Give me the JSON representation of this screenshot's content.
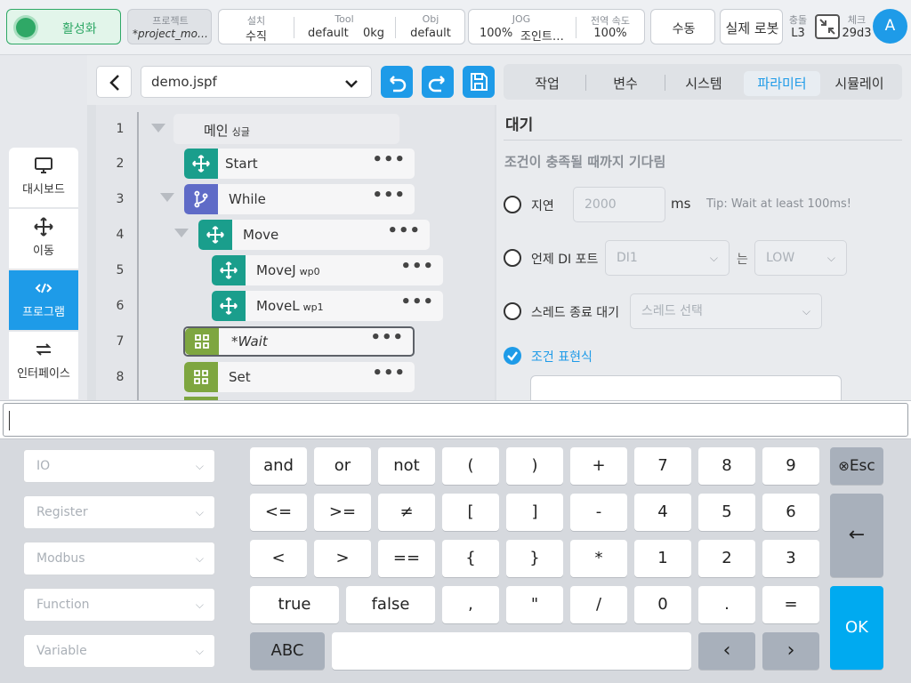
{
  "topbar": {
    "activate_label": "활성화",
    "project": {
      "label": "프로젝트",
      "value": "*project_mo…"
    },
    "install": {
      "label": "설치",
      "value": "수직"
    },
    "tool": {
      "label": "Tool",
      "value_name": "default",
      "value_weight": "0kg"
    },
    "obj": {
      "label": "Obj",
      "value": "default"
    },
    "jog": {
      "label": "JOG",
      "value_percent": "100%",
      "value_mode": "조인트…"
    },
    "global_speed": {
      "label": "전역 속도",
      "value": "100%"
    },
    "manual_label": "수동",
    "real_robot_label": "실제 로봇",
    "collision": {
      "label": "충돌",
      "value": "L3"
    },
    "check": {
      "label": "체크",
      "value": "29d3"
    },
    "avatar_letter": "A"
  },
  "nav": {
    "items": [
      {
        "label": "대시보드",
        "icon": "monitor-icon"
      },
      {
        "label": "이동",
        "icon": "move-arrows-icon"
      },
      {
        "label": "프로그램",
        "icon": "code-icon"
      },
      {
        "label": "인터페이스",
        "icon": "swap-arrows-icon"
      }
    ],
    "active_index": 2
  },
  "program": {
    "file_name": "demo.jspf",
    "lines": [
      {
        "no": "1",
        "label": "메인",
        "sub": "싱글"
      },
      {
        "no": "2",
        "label": "Start",
        "sub": ""
      },
      {
        "no": "3",
        "label": "While",
        "sub": ""
      },
      {
        "no": "4",
        "label": "Move",
        "sub": ""
      },
      {
        "no": "5",
        "label": "MoveJ",
        "sub": "wp0"
      },
      {
        "no": "6",
        "label": "MoveL",
        "sub": "wp1"
      },
      {
        "no": "7",
        "label": "*Wait",
        "sub": ""
      },
      {
        "no": "8",
        "label": "Set",
        "sub": ""
      }
    ],
    "selected_line": "7"
  },
  "tabs": [
    "작업",
    "변수",
    "시스템",
    "파라미터",
    "시뮬레이"
  ],
  "active_tab": "파라미터",
  "wait_panel": {
    "title": "대기",
    "subtitle": "조건이 충족될 때까지 기다림",
    "delay": {
      "label": "지연",
      "value": "2000",
      "unit": "ms",
      "tip": "Tip: Wait at least 100ms!"
    },
    "di_port": {
      "label": "언제 DI 포트",
      "port": "DI1",
      "is_label": "는",
      "level": "LOW"
    },
    "thread": {
      "label": "스레드 종료 대기",
      "placeholder": "스레드 선택"
    },
    "condition": {
      "label": "조건 표현식",
      "checked": true
    }
  },
  "expression": {
    "value": ""
  },
  "keyboard": {
    "selects": [
      "IO",
      "Register",
      "Modbus",
      "Function",
      "Variable"
    ],
    "row1": [
      "and",
      "or",
      "not",
      "(",
      ")",
      "+",
      "7",
      "8",
      "9"
    ],
    "row2": [
      "<=",
      ">=",
      "≠",
      "[",
      "]",
      "-",
      "4",
      "5",
      "6"
    ],
    "row3": [
      "<",
      ">",
      "==",
      "{",
      "}",
      "*",
      "1",
      "2",
      "3"
    ],
    "row4": [
      "true",
      "false",
      ",",
      "\"",
      "/",
      "0",
      ".",
      "="
    ],
    "esc_label": "Esc",
    "backspace_label": "←",
    "ok_label": "OK",
    "abc_label": "ABC",
    "cursor_left_label": "‹",
    "cursor_right_label": "›"
  },
  "colors": {
    "accent": "#1e9be8",
    "move_node": "#1a9e8c",
    "while_node": "#5f6bc7",
    "wait_node": "#7ea640",
    "active_green": "#2fa866"
  }
}
